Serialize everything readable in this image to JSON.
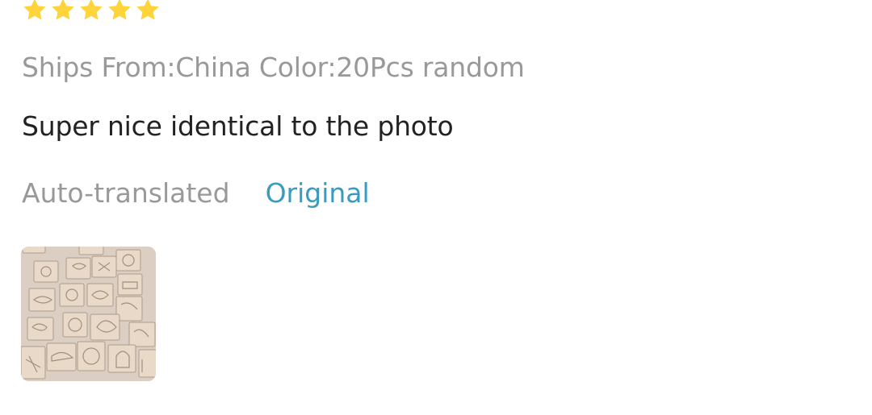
{
  "review": {
    "rating": 5,
    "rating_max": 5,
    "meta": "Ships From:China Color:20Pcs random",
    "text": "Super nice identical to the photo",
    "auto_translated_label": "Auto-translated",
    "original_link_label": "Original"
  },
  "colors": {
    "star": "#FFD43B",
    "link": "#3a9bc0",
    "muted_text": "#999999",
    "body_text": "#222222"
  }
}
